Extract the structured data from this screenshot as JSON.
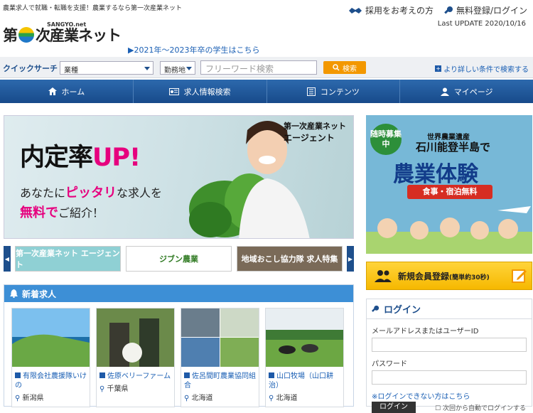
{
  "header": {
    "tagline": "農業求人で就職・転職を支援！農業するなら第一次産業ネット",
    "logo_text": "第一次産業ネット",
    "logo_sub": "SANGYO.net",
    "recruit_link": "採用をお考えの方",
    "login_link": "無料登録/ログイン",
    "last_update": "Last UPDATE 2020/10/16",
    "students_link": "▶2021年～2023年卒の学生はこちら"
  },
  "quick": {
    "label": "クイックサーチ",
    "category": "業種",
    "location": "勤務地",
    "keyword_placeholder": "フリーワード検索",
    "search_btn": "検索",
    "advanced": "より詳しい条件で検索する"
  },
  "nav": [
    {
      "label": "ホーム",
      "icon": "home-icon"
    },
    {
      "label": "求人情報検索",
      "icon": "job-search-icon"
    },
    {
      "label": "コンテンツ",
      "icon": "contents-icon"
    },
    {
      "label": "マイページ",
      "icon": "user-icon"
    }
  ],
  "banner": {
    "main_a": "内定率",
    "main_b": "UP!",
    "sub1_a": "あなたに",
    "sub1_b": "ピッタリ",
    "sub1_c": "な求人を",
    "sub2_a": "無料で",
    "sub2_b": "ご紹介！",
    "brand_a": "第一次産業ネット",
    "brand_b": "エージェント"
  },
  "thumbs": [
    {
      "label": "第一次産業ネット エージェント"
    },
    {
      "label": "ジブン農業"
    },
    {
      "label": "地域おこし協力隊 求人特集"
    }
  ],
  "new_jobs": {
    "title": "新着求人",
    "items": [
      {
        "name": "有限会社農援隊いけの",
        "pref": "新潟県"
      },
      {
        "name": "佐原ベリーファーム",
        "pref": "千葉県"
      },
      {
        "name": "佐呂間町農業協同組合",
        "pref": "北海道"
      },
      {
        "name": "山口牧場（山口耕治）",
        "pref": "北海道"
      }
    ]
  },
  "side_ad": {
    "badge": "随時募集中",
    "line1": "世界農業遺産",
    "line2": "石川能登半島で",
    "line3": "農業体験",
    "line4": "食事・宿泊無料"
  },
  "register": {
    "label": "新規会員登録",
    "note": "(簡単約30秒)"
  },
  "login": {
    "title": "ログイン",
    "email_label": "メールアドレスまたはユーザーID",
    "password_label": "パスワード",
    "forgot": "※ログインできない方はこちら",
    "button": "ログイン",
    "auto": "次回から自動でログインする"
  }
}
